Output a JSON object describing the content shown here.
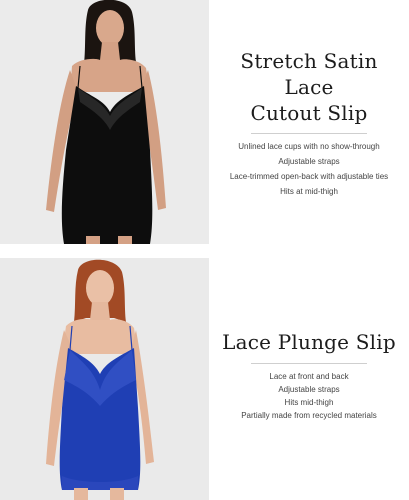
{
  "products": [
    {
      "title_line1": "Stretch Satin Lace",
      "title_line2": "Cutout Slip",
      "features": [
        "Unlined lace cups with no show-through",
        "Adjustable straps",
        "Lace-trimmed open-back with adjustable ties",
        "Hits at mid-thigh"
      ],
      "slip_color": "#0d0d0d"
    },
    {
      "title_line1": "Lace Plunge Slip",
      "features": [
        "Lace at front and back",
        "Adjustable straps",
        "Hits mid-thigh",
        "Partially made from recycled materials"
      ],
      "slip_color": "#1f3fb4"
    }
  ],
  "colors": {
    "photo_background": "#ebebeb",
    "divider": "#cfcfcf",
    "text": "#222222"
  }
}
